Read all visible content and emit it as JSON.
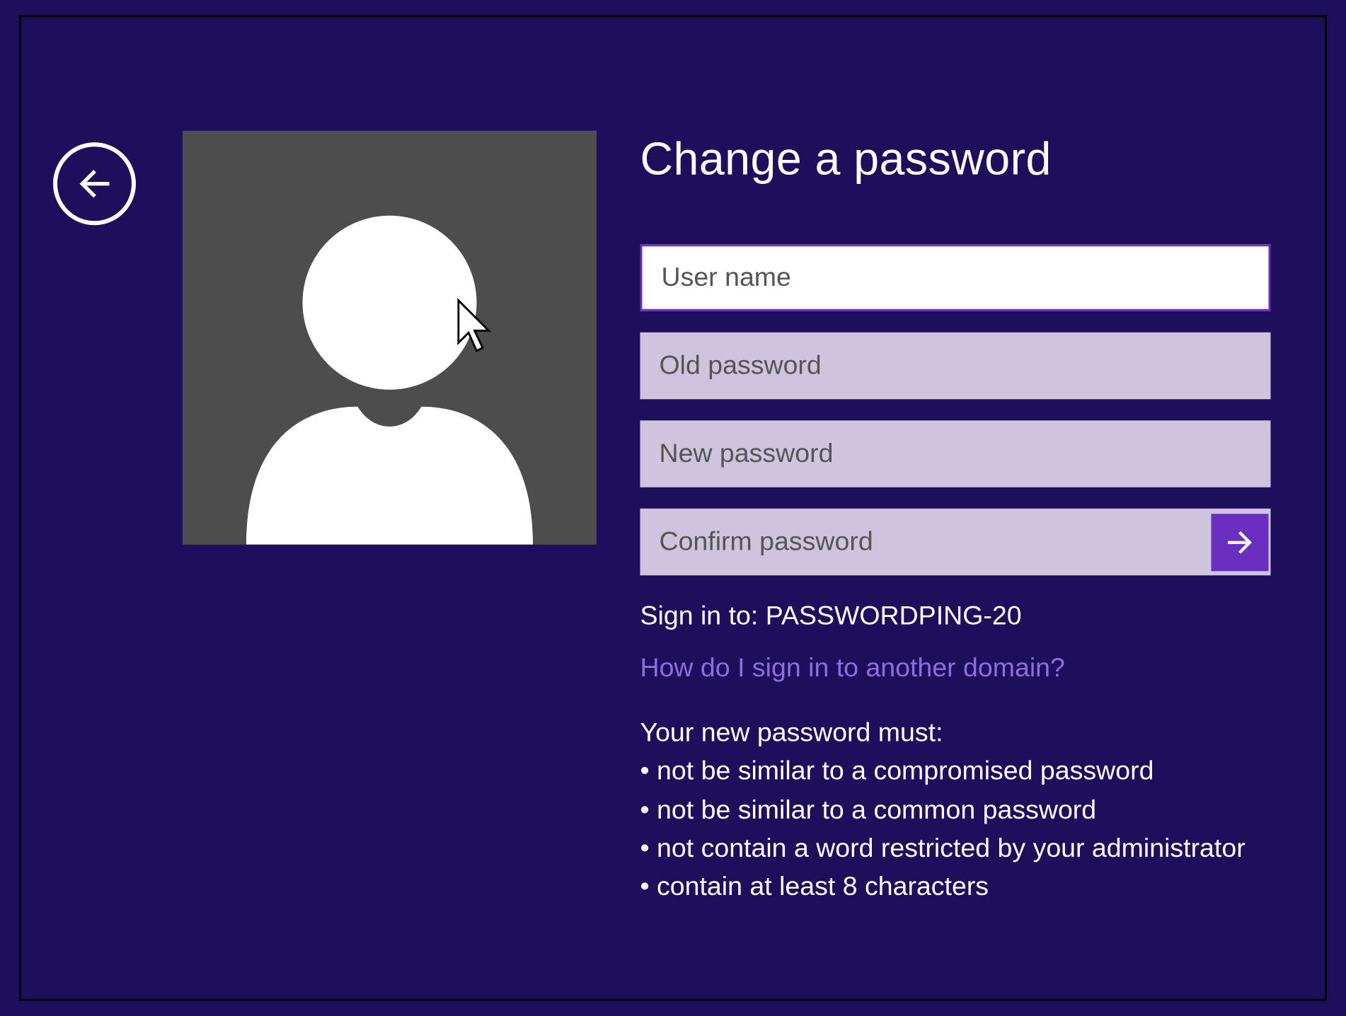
{
  "title": "Change a password",
  "fields": {
    "username": {
      "placeholder": "User name",
      "value": ""
    },
    "old_password": {
      "placeholder": "Old password",
      "value": ""
    },
    "new_password": {
      "placeholder": "New password",
      "value": ""
    },
    "confirm_password": {
      "placeholder": "Confirm password",
      "value": ""
    }
  },
  "signin_to": "Sign in to: PASSWORDPING-20",
  "domain_link": "How do I sign in to another domain?",
  "requirements": {
    "heading": "Your new password must:",
    "items": [
      "• not be similar to a compromised password",
      "• not be similar to a common password",
      "• not contain a word restricted by your administrator",
      "• contain at least 8 characters"
    ]
  },
  "colors": {
    "background": "#1e0f5c",
    "accent": "#6b2fbf",
    "link": "#8c6fdf",
    "input_dim": "#cfc4de"
  }
}
